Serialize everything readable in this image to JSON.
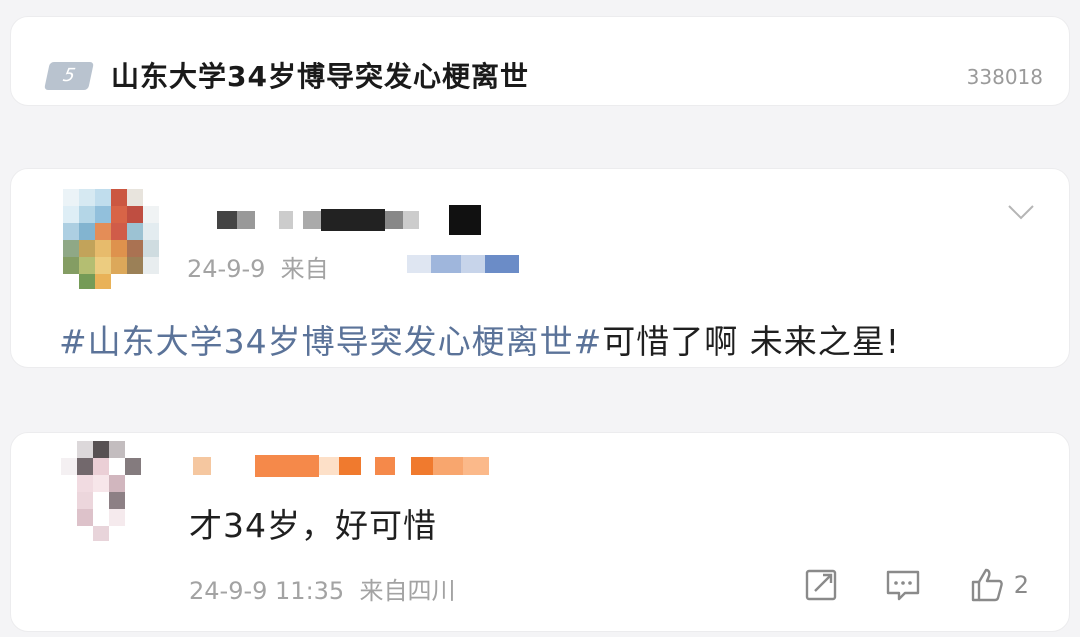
{
  "trending": {
    "rank": "5",
    "title": "山东大学34岁博导突发心梗离世",
    "count": "338018"
  },
  "post": {
    "date": "24-9-9",
    "source_prefix": "来自",
    "hashtag": "#山东大学34岁博导突发心梗离世#",
    "text": "可惜了啊 未来之星!"
  },
  "comment": {
    "text": "才34岁，好可惜",
    "timestamp": "24-9-9 11:35",
    "source": "来自四川",
    "like_count": "2"
  },
  "icons": {
    "chevron": "chevron-down-icon",
    "share": "share-icon",
    "reply": "comment-icon",
    "like": "thumbs-up-icon"
  },
  "colors": {
    "hashtag": "#5b7399",
    "meta": "#a3a3a3",
    "card": "#ffffff",
    "background": "#f4f4f6"
  }
}
